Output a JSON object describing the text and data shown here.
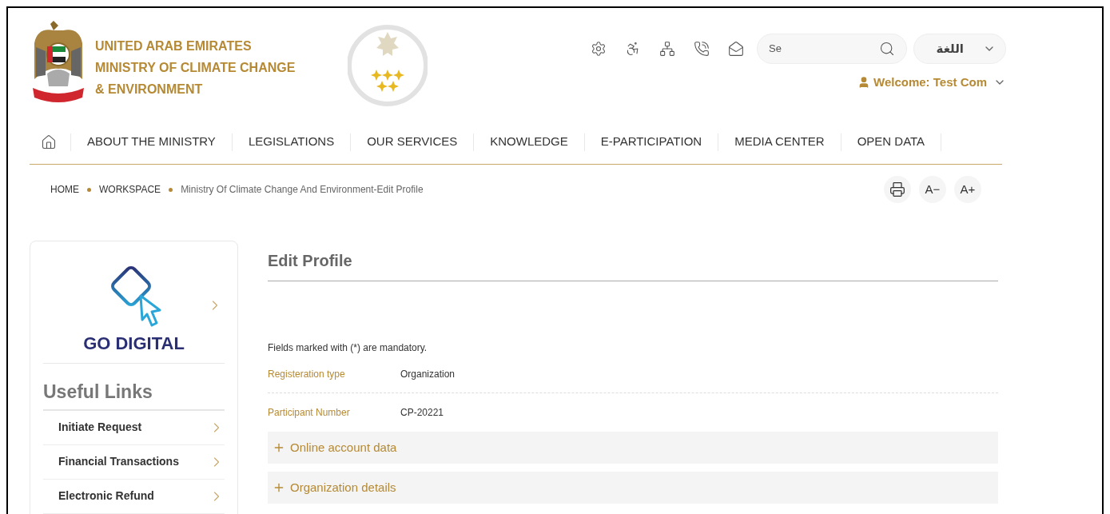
{
  "header": {
    "org_lines": [
      "UNITED ARAB EMIRATES",
      "MINISTRY OF CLIMATE CHANGE",
      "& ENVIRONMENT"
    ],
    "search": {
      "value": "Se"
    },
    "language": "اللغة",
    "welcome": "Welcome: Test Com"
  },
  "nav": {
    "items": [
      "ABOUT THE MINISTRY",
      "LEGISLATIONS",
      "OUR SERVICES",
      "KNOWLEDGE",
      "E-PARTICIPATION",
      "MEDIA CENTER",
      "OPEN DATA"
    ]
  },
  "breadcrumb": [
    "HOME",
    "WORKSPACE",
    "Ministry Of Climate Change And Environment-Edit Profile"
  ],
  "text_tools": [
    "A−",
    "A+"
  ],
  "sidebar": {
    "logo_text": "GO DIGITAL",
    "heading": "Useful Links",
    "links": [
      "Initiate Request",
      "Financial Transactions",
      "Electronic Refund"
    ]
  },
  "main": {
    "title": "Edit Profile",
    "note": "Fields marked with (*) are mandatory.",
    "fields": [
      {
        "label": "Registeration type",
        "value": "Organization"
      },
      {
        "label": "Participant Number",
        "value": "CP-20221"
      }
    ],
    "sections": [
      {
        "title": "Online account data",
        "expanded": false
      },
      {
        "title": "Organization details",
        "expanded": false
      }
    ]
  }
}
